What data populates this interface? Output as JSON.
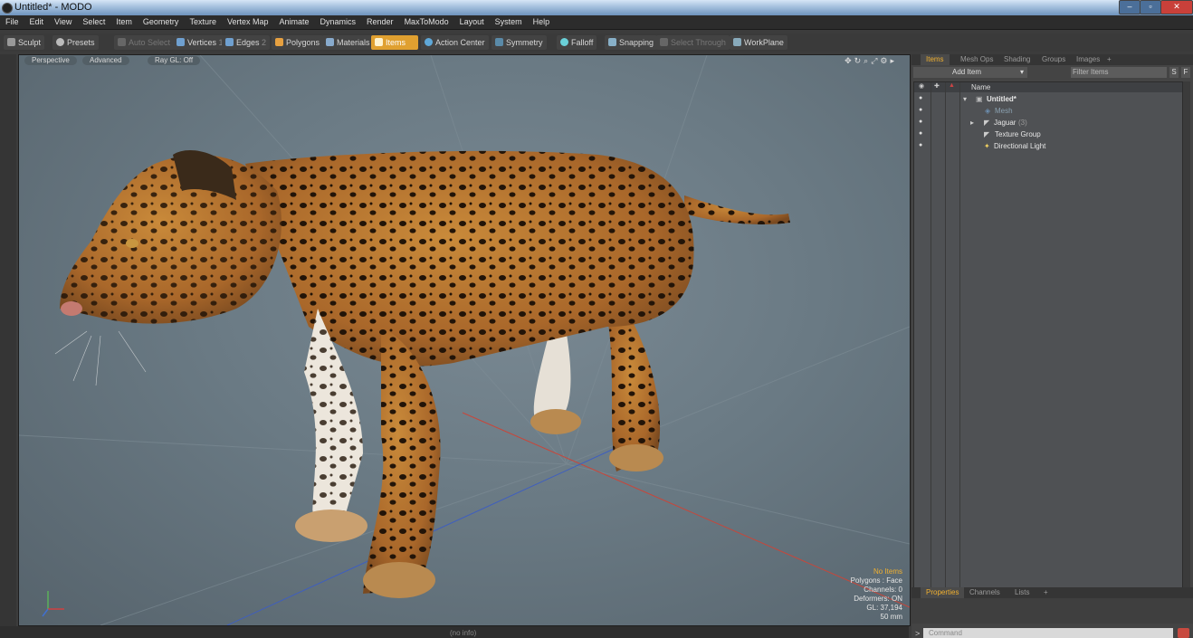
{
  "window": {
    "title": "Untitled* - MODO",
    "min_label": "–",
    "max_label": "▫",
    "close_label": "✕"
  },
  "menu": [
    "File",
    "Edit",
    "View",
    "Select",
    "Item",
    "Geometry",
    "Texture",
    "Vertex Map",
    "Animate",
    "Dynamics",
    "Render",
    "MaxToModo",
    "Layout",
    "System",
    "Help"
  ],
  "toolbar": {
    "sculpt": "Sculpt",
    "presets": "Presets",
    "auto_select": "Auto Select",
    "vertices": "Vertices",
    "vertices_count": "1",
    "edges": "Edges",
    "edges_count": "2",
    "polygons": "Polygons",
    "materials": "Materials",
    "items": "Items",
    "action_center": "Action Center",
    "symmetry": "Symmetry",
    "falloff": "Falloff",
    "snapping": "Snapping",
    "select_through": "Select Through",
    "workplane": "WorkPlane"
  },
  "viewport": {
    "tabs": [
      "Perspective",
      "Advanced",
      "Ray GL: Off"
    ],
    "info": {
      "selection": "No Items",
      "polygons": "Polygons : Face",
      "channels": "Channels: 0",
      "deformers": "Deformers: ON",
      "gl": "GL: 37,194",
      "focal": "50 mm"
    }
  },
  "items_panel": {
    "tabs": [
      "Items",
      "Mesh Ops",
      "Shading",
      "Groups",
      "Images",
      "+"
    ],
    "add_item": "Add Item",
    "filter_placeholder": "Filter Items",
    "s_btn": "S",
    "f_btn": "F",
    "column_name": "Name",
    "rows": [
      {
        "label": "Untitled*",
        "count": ""
      },
      {
        "label": "Mesh",
        "count": ""
      },
      {
        "label": "Jaguar",
        "count": "(3)"
      },
      {
        "label": "Texture Group",
        "count": ""
      },
      {
        "label": "Directional Light",
        "count": ""
      }
    ]
  },
  "properties_panel": {
    "tabs": [
      "Properties",
      "Channels",
      "Lists",
      "+"
    ]
  },
  "status": {
    "info": "(no info)",
    "command_placeholder": "Command",
    "prompt": ">"
  },
  "colors": {
    "accent": "#f0b030",
    "viewport_bg": "#6a7a84",
    "panel_bg": "#444444"
  }
}
